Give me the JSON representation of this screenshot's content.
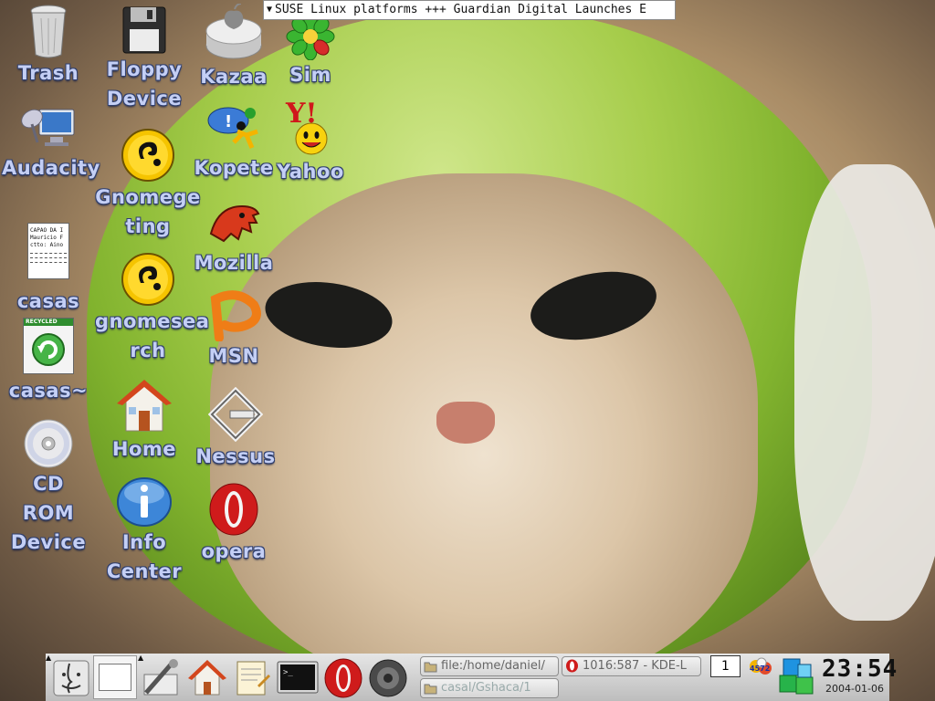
{
  "ticker": {
    "text": "SUSE Linux platforms +++  Guardian Digital Launches E"
  },
  "desktop_icons": {
    "trash": "Trash",
    "floppy_1": "Floppy",
    "floppy_2": "Device",
    "kazaa": "Kazaa",
    "sim": "Sim",
    "audacity": "Audacity",
    "gnomeget_1": "Gnomege",
    "gnomeget_2": "ting",
    "kopete": "Kopete",
    "yahoo": "Yahoo",
    "mozilla": "Mozilla",
    "casas": "casas",
    "gnomesearch_1": "gnomesea",
    "gnomesearch_2": "rch",
    "msn": "MSN",
    "casas_backup": "casas~",
    "home": "Home",
    "nessus": "Nessus",
    "cdrom_1": "CD",
    "cdrom_2": "ROM",
    "cdrom_3": "Device",
    "info_1": "Info",
    "info_2": "Center",
    "opera": "opera"
  },
  "casas_doc": {
    "line1": "CAPAO DA I",
    "line2": "Mauricio F",
    "line3": "ctto: Aino"
  },
  "trash_badge": "RECYCLED",
  "taskbar": {
    "task1": "file:/home/daniel/",
    "task2": "1016:587 - KDE-L",
    "task3": "casal/Gshaca/1",
    "pager": "1",
    "tray_counter": "4572",
    "clock_time": "23:54",
    "clock_date": "2004-01-06"
  }
}
